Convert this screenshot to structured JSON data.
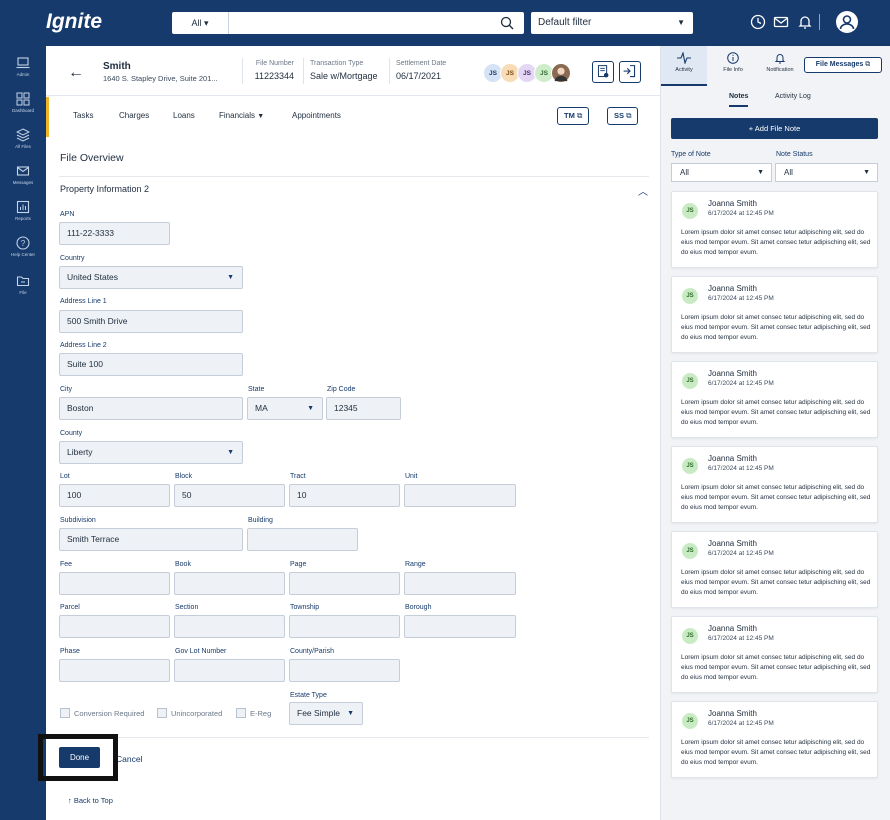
{
  "app": {
    "logo": "Ignite"
  },
  "topbar": {
    "search_scope": "All",
    "search_placeholder": "",
    "filter": "Default filter"
  },
  "leftnav": {
    "items": [
      {
        "label": "Admin",
        "icon": "laptop-icon"
      },
      {
        "label": "Dashboard",
        "icon": "dashboard-icon"
      },
      {
        "label": "All Files",
        "icon": "layers-icon"
      },
      {
        "label": "Messages",
        "icon": "mail-icon"
      },
      {
        "label": "Reports",
        "icon": "report-icon"
      },
      {
        "label": "Help Center",
        "icon": "help-icon"
      },
      {
        "label": "File",
        "icon": "folder-icon"
      }
    ]
  },
  "file": {
    "name": "Smith",
    "address": "1640 S. Stapley Drive, Suite 201...",
    "file_number_label": "File Number",
    "file_number": "11223344",
    "transaction_type_label": "Transaction Type",
    "transaction_type": "Sale w/Mortgage",
    "settlement_date_label": "Settlement Date",
    "settlement_date": "06/17/2021",
    "chips": [
      "JS",
      "JS",
      "JS",
      "JS"
    ]
  },
  "tabs": {
    "items": [
      "Tasks",
      "Charges",
      "Loans",
      "Financials",
      "Appointments"
    ],
    "tm": "TM",
    "ss": "SS"
  },
  "form": {
    "title": "File Overview",
    "section": "Property Information 2",
    "apn_label": "APN",
    "apn": "111-22-3333",
    "country_label": "Country",
    "country": "United States",
    "addr1_label": "Address Line 1",
    "addr1": "500 Smith Drive",
    "addr2_label": "Address Line 2",
    "addr2": "Suite 100",
    "city_label": "City",
    "city": "Boston",
    "state_label": "State",
    "state": "MA",
    "zip_label": "Zip Code",
    "zip": "12345",
    "county_label": "County",
    "county": "Liberty",
    "lot_label": "Lot",
    "lot": "100",
    "block_label": "Block",
    "block": "50",
    "tract_label": "Tract",
    "tract": "10",
    "unit_label": "Unit",
    "unit": "",
    "subdivision_label": "Subdivision",
    "subdivision": "Smith Terrace",
    "building_label": "Building",
    "building": "",
    "fee_label": "Fee",
    "book_label": "Book",
    "page_label": "Page",
    "range_label": "Range",
    "parcel_label": "Parcel",
    "section_label": "Section",
    "township_label": "Township",
    "borough_label": "Borough",
    "phase_label": "Phase",
    "govlot_label": "Gov Lot Number",
    "countyparish_label": "County/Parish",
    "estate_label": "Estate Type",
    "estate": "Fee Simple",
    "cb1": "Conversion Required",
    "cb2": "Unincorporated",
    "cb3": "E-Reg",
    "done": "Done",
    "cancel": "Cancel",
    "back_to_top": "Back to Top"
  },
  "panel": {
    "tabs": [
      "Activity",
      "File Info",
      "Notification"
    ],
    "file_messages": "File Messages",
    "subtabs": [
      "Notes",
      "Activity Log"
    ],
    "add_note": "+ Add File Note",
    "type_label": "Type of Note",
    "type_value": "All",
    "status_label": "Note Status",
    "status_value": "All",
    "notes": [
      {
        "initials": "JS",
        "name": "Joanna Smith",
        "date": "6/17/2024 at 12:45 PM",
        "body": "Lorem ipsum dolor sit amet consec tetur adipisching elit, sed do eius mod tempor evum. Sit amet consec tetur adipisching elit, sed do eius mod tempor evum."
      },
      {
        "initials": "JS",
        "name": "Joanna Smith",
        "date": "6/17/2024 at 12:45 PM",
        "body": "Lorem ipsum dolor sit amet consec tetur adipisching elit, sed do eius mod tempor evum. Sit amet consec tetur adipisching elit, sed do eius mod tempor evum."
      },
      {
        "initials": "JS",
        "name": "Joanna Smith",
        "date": "6/17/2024 at 12:45 PM",
        "body": "Lorem ipsum dolor sit amet consec tetur adipisching elit, sed do eius mod tempor evum. Sit amet consec tetur adipisching elit, sed do eius mod tempor evum."
      },
      {
        "initials": "JS",
        "name": "Joanna Smith",
        "date": "6/17/2024 at 12:45 PM",
        "body": "Lorem ipsum dolor sit amet consec tetur adipisching elit, sed do eius mod tempor evum. Sit amet consec tetur adipisching elit, sed do eius mod tempor evum."
      },
      {
        "initials": "JS",
        "name": "Joanna Smith",
        "date": "6/17/2024 at 12:45 PM",
        "body": "Lorem ipsum dolor sit amet consec tetur adipisching elit, sed do eius mod tempor evum. Sit amet consec tetur adipisching elit, sed do eius mod tempor evum."
      },
      {
        "initials": "JS",
        "name": "Joanna Smith",
        "date": "6/17/2024 at 12:45 PM",
        "body": "Lorem ipsum dolor sit amet consec tetur adipisching elit, sed do eius mod tempor evum. Sit amet consec tetur adipisching elit, sed do eius mod tempor evum."
      },
      {
        "initials": "JS",
        "name": "Joanna Smith",
        "date": "6/17/2024 at 12:45 PM",
        "body": "Lorem ipsum dolor sit amet consec tetur adipisching elit, sed do eius mod tempor evum. Sit amet consec tetur adipisching elit, sed do eius mod tempor evum."
      }
    ]
  },
  "colors": {
    "navy": "#163a6b",
    "accent": "#f0b429",
    "field_bg": "#eef1f5"
  }
}
